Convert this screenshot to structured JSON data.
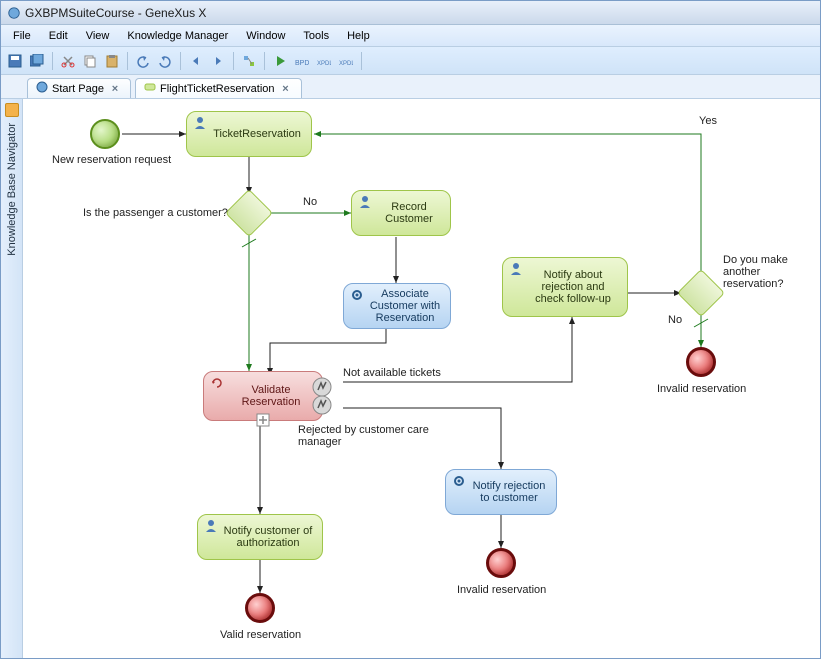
{
  "app": {
    "title": "GXBPMSuiteCourse - GeneXus X"
  },
  "menu": {
    "items": [
      "File",
      "Edit",
      "View",
      "Knowledge Manager",
      "Window",
      "Tools",
      "Help"
    ]
  },
  "sidebar": {
    "label": "Knowledge Base Navigator"
  },
  "tabs": {
    "items": [
      {
        "label": "Start Page",
        "active": false
      },
      {
        "label": "FlightTicketReservation",
        "active": true
      }
    ]
  },
  "diagram": {
    "startLabel": "New reservation request",
    "tasks": {
      "ticketReservation": "TicketReservation",
      "recordCustomer": "Record Customer",
      "associateCustomer": "Associate Customer with Reservation",
      "validateReservation": "Validate Reservation",
      "notifyRejectFollowup": "Notify about rejection and check follow-up",
      "notifyRejectCustomer": "Notify rejection to customer",
      "notifyAuth": "Notify customer of authorization"
    },
    "gatewayLabels": {
      "isCustomer": "Is the passenger a customer?",
      "another": "Do you make another reservation?"
    },
    "edgeLabels": {
      "no1": "No",
      "notAvailable": "Not available tickets",
      "rejectedBy": "Rejected by customer care manager",
      "yes": "Yes",
      "no2": "No"
    },
    "endLabels": {
      "invalid1": "Invalid reservation",
      "invalid2": "Invalid reservation",
      "valid": "Valid reservation"
    }
  }
}
